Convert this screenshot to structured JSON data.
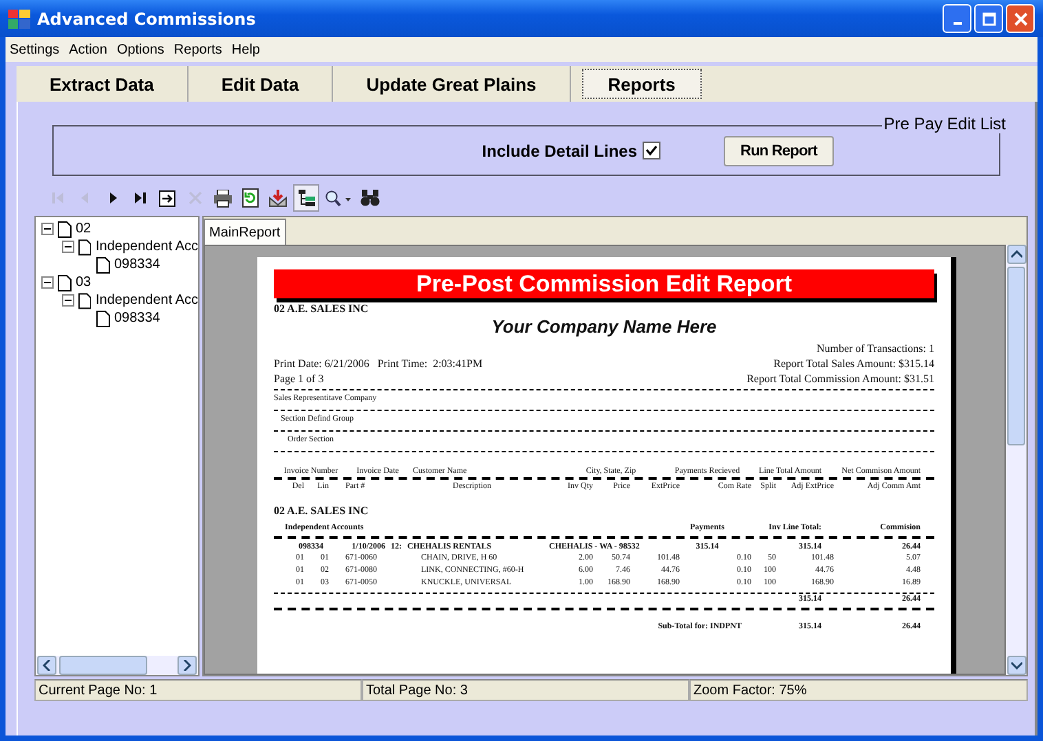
{
  "window": {
    "title": "Advanced Commissions"
  },
  "menu": [
    "Settings",
    "Action",
    "Options",
    "Reports",
    "Help"
  ],
  "tabs": [
    {
      "label": "Extract Data",
      "selected": false
    },
    {
      "label": "Edit Data",
      "selected": false
    },
    {
      "label": "Update Great Plains",
      "selected": false
    },
    {
      "label": "Reports",
      "selected": true
    }
  ],
  "options": {
    "title": "Pre Pay Edit List",
    "include_detail": {
      "label": "Include Detail Lines",
      "checked": true
    },
    "run_button": "Run Report"
  },
  "toolbar": [
    {
      "kind": "first",
      "disabled": true,
      "pressed": false
    },
    {
      "kind": "prev",
      "disabled": true,
      "pressed": false
    },
    {
      "kind": "next",
      "disabled": false,
      "pressed": false
    },
    {
      "kind": "last",
      "disabled": false,
      "pressed": false
    },
    {
      "kind": "goto",
      "disabled": false,
      "pressed": false
    },
    {
      "kind": "close",
      "disabled": true,
      "pressed": false
    },
    {
      "kind": "print",
      "disabled": false,
      "pressed": false
    },
    {
      "kind": "refresh",
      "disabled": false,
      "pressed": false
    },
    {
      "kind": "export",
      "disabled": false,
      "pressed": false
    },
    {
      "kind": "tree",
      "disabled": false,
      "pressed": true
    },
    {
      "kind": "zoom",
      "disabled": false,
      "pressed": false
    },
    {
      "kind": "search",
      "disabled": false,
      "pressed": false
    }
  ],
  "tree": [
    {
      "label": "02",
      "expanded": true,
      "children": [
        {
          "label": "Independent Acc",
          "expanded": true,
          "children": [
            {
              "label": "098334"
            }
          ]
        }
      ]
    },
    {
      "label": "03",
      "expanded": true,
      "children": [
        {
          "label": "Independent Acc",
          "expanded": true,
          "children": [
            {
              "label": "098334"
            }
          ]
        }
      ]
    }
  ],
  "report_tabs": [
    {
      "label": "MainReport",
      "selected": true
    }
  ],
  "report": {
    "banner": "Pre-Post Commission Edit Report",
    "company": "02 A.E. SALES INC",
    "company_name": "Your Company Name Here",
    "print_info": "Print Date: 6/21/2006   Print Time:  2:03:41PM",
    "page": "Page 1 of 3",
    "summary": [
      "Number of Transactions:  1",
      "Report Total Sales Amount: $315.14",
      "Report Total Commission Amount: $31.51"
    ],
    "sections": [
      "Sales Representitave Company",
      "Section Defind Group",
      "Order Section"
    ],
    "order_headers": [
      "Invoice Number",
      "Invoice Date",
      "Customer Name",
      "City, State, Zip",
      "Payments Recieved",
      "Line Total Amount",
      "Net Commison Amount"
    ],
    "line_headers": [
      "Del",
      "Lin",
      "Part #",
      "Description",
      "Inv Qty",
      "Price",
      "ExtPrice",
      "Com Rate",
      "Split",
      "Adj ExtPrice",
      "Adj Comm Amt"
    ],
    "group": "02 A.E. SALES INC",
    "subgroup": {
      "label": "Independent Accounts",
      "columns": [
        "Payments",
        "Inv Line Total:",
        "Commision"
      ]
    },
    "order": {
      "invoice": "098334",
      "date": "1/10/2006",
      "time": "12:",
      "customer": "CHEHALIS RENTALS",
      "city": "CHEHALIS - WA - 98532",
      "payments": "315.14",
      "line_total": "315.14",
      "commission": "26.44"
    },
    "lines": [
      [
        "01",
        "01",
        "671-0060",
        "CHAIN, DRIVE, H 60",
        "2.00",
        "50.74",
        "101.48",
        "0.10",
        "50",
        "101.48",
        "5.07"
      ],
      [
        "01",
        "02",
        "671-0080",
        "LINK, CONNECTING, #60-H",
        "6.00",
        "7.46",
        "44.76",
        "0.10",
        "100",
        "44.76",
        "4.48"
      ],
      [
        "01",
        "03",
        "671-0050",
        "KNUCKLE, UNIVERSAL",
        "1.00",
        "168.90",
        "168.90",
        "0.10",
        "100",
        "168.90",
        "16.89"
      ]
    ],
    "totals": [
      "315.14",
      "26.44"
    ],
    "subtotal": {
      "label": "Sub-Total for:  INDPNT",
      "values": [
        "315.14",
        "26.44"
      ]
    }
  },
  "status_bar": [
    "Current Page No: 1",
    "Total Page No: 3",
    "Zoom Factor: 75%"
  ]
}
